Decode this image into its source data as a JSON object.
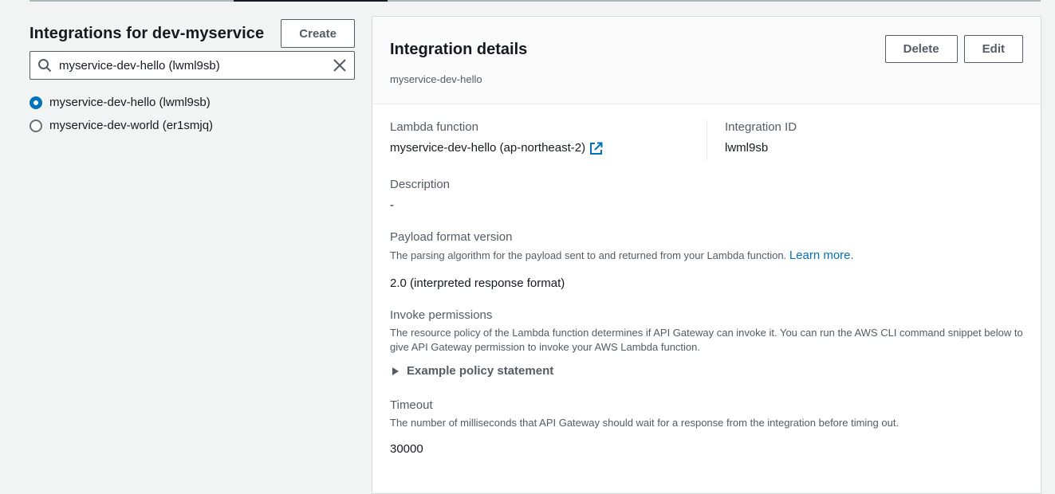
{
  "integrations": {
    "title": "Integrations for dev-myservice",
    "create_label": "Create",
    "search_value": "myservice-dev-hello (lwml9sb)",
    "items": [
      {
        "label": "myservice-dev-hello (lwml9sb)",
        "checked": true
      },
      {
        "label": "myservice-dev-world (er1smjq)",
        "checked": false
      }
    ]
  },
  "details": {
    "title": "Integration details",
    "subtitle": "myservice-dev-hello",
    "delete_label": "Delete",
    "edit_label": "Edit",
    "lambda_label": "Lambda function",
    "lambda_value": "myservice-dev-hello (ap-northeast-2)",
    "integration_id_label": "Integration ID",
    "integration_id_value": "lwml9sb",
    "description_label": "Description",
    "description_value": "-",
    "payload_label": "Payload format version",
    "payload_desc": "The parsing algorithm for the payload sent to and returned from your Lambda function.",
    "payload_link": "Learn more.",
    "payload_value": "2.0 (interpreted response format)",
    "invoke_label": "Invoke permissions",
    "invoke_desc": "The resource policy of the Lambda function determines if API Gateway can invoke it. You can run the AWS CLI command snippet below to give API Gateway permission to invoke your AWS Lambda function.",
    "example_label": "Example policy statement",
    "timeout_label": "Timeout",
    "timeout_desc": "The number of milliseconds that API Gateway should wait for a response from the integration before timing out.",
    "timeout_value": "30000"
  },
  "icons": {
    "search": "search-icon",
    "clear": "close-icon",
    "external": "external-link-icon",
    "expand": "caret-right-icon"
  },
  "colors": {
    "accent": "#0073bb",
    "background": "#f2f3f3"
  }
}
